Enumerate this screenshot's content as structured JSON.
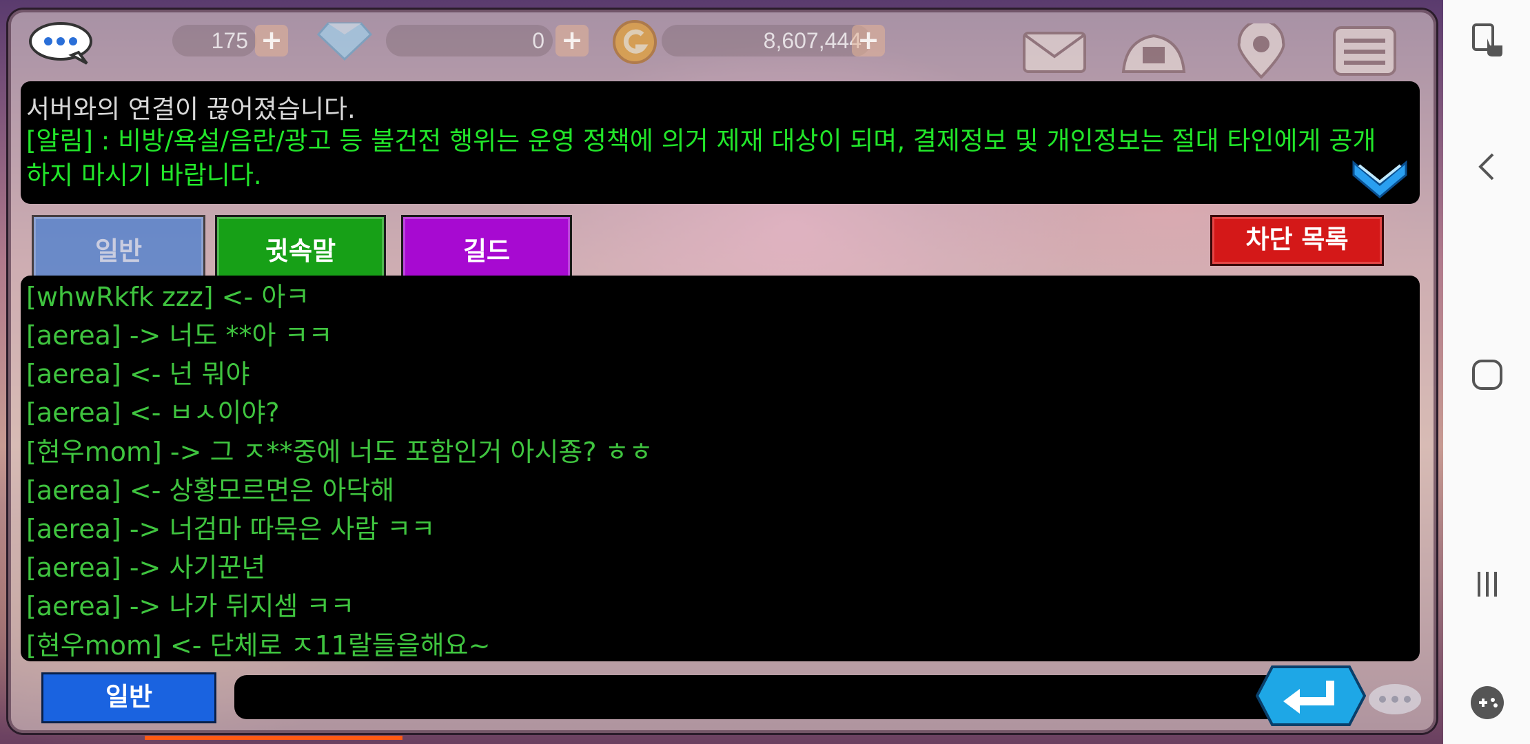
{
  "topbar": {
    "hearts_value": "175",
    "gems_value": "0",
    "gold_value": "8,607,444",
    "plus_label": "+"
  },
  "notice": {
    "system_line": "서버와의 연결이 끊어졌습니다.",
    "alert_line": "[알림] : 비방/욕설/음란/광고 등 불건전 행위는 운영 정책에 의거 제재 대상이 되며, 결제정보 및 개인정보는 절대 타인에게 공개하지 마시기 바랍니다."
  },
  "tabs": {
    "normal": "일반",
    "whisper": "귓속말",
    "guild": "길드",
    "block_list": "차단 목록"
  },
  "chat_log": [
    "[whwRkfk zzz] <- 아ㅋ",
    "[aerea] -> 너도 **아 ㅋㅋ",
    "[aerea] <- 넌 뭐야",
    "[aerea] <- ㅂㅅ이야?",
    "[현우mom] -> 그 ㅈ**중에 너도 포함인거 아시죵? ㅎㅎ",
    "[aerea] <- 상황모르면은 아닥해",
    "[aerea] -> 너검마 따묵은 사람 ㅋㅋ",
    "[aerea] -> 사기꾼년",
    "[aerea] -> 나가 뒤지셈 ㅋㅋ",
    "[현우mom] <- 단체로 ㅈ11랄들을해요~"
  ],
  "input": {
    "channel_label": "일반",
    "value": ""
  },
  "colors": {
    "chat_text": "#3fc43f",
    "alert_text": "#22e62a",
    "whisper_tab": "#17a017",
    "guild_tab": "#a70ad1",
    "block_btn": "#d41818",
    "channel_btn": "#1a63e0"
  }
}
